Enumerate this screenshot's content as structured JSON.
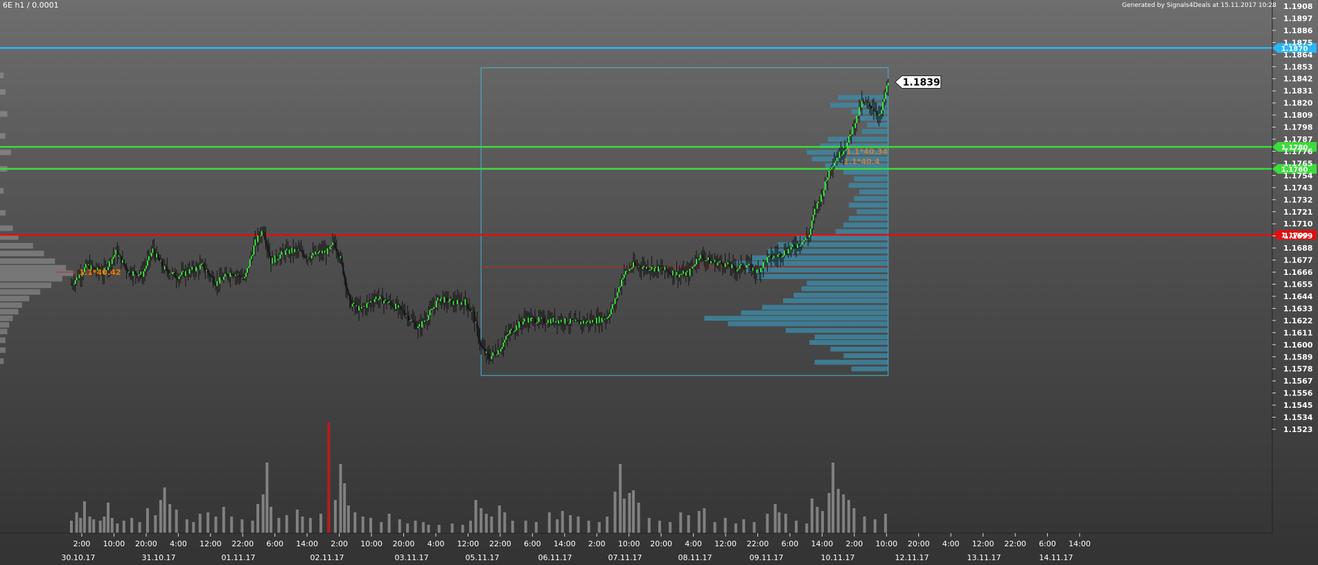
{
  "header": {
    "title": "6E h1 / 0.0001",
    "generated": "Generated by Signals4Deals at 15.11.2017 10:28"
  },
  "colors": {
    "background_top": "#6e6e6e",
    "background_bottom": "#333333",
    "bull_candle": "#39e639",
    "bear_candle": "#111111",
    "volume": "#9a9a9a",
    "volume_spike": "#b71c1c",
    "profile_fill": "#3d8aa6",
    "box_stroke": "#4ab6d4"
  },
  "chart_data": {
    "type": "candlestick",
    "title": "6E h1 / 0.0001",
    "y_ticks": [
      1.1908,
      1.1897,
      1.1886,
      1.1875,
      1.1864,
      1.1853,
      1.1842,
      1.1831,
      1.182,
      1.1809,
      1.1798,
      1.1787,
      1.1776,
      1.1765,
      1.1754,
      1.1743,
      1.1732,
      1.1721,
      1.171,
      1.1699,
      1.1688,
      1.1677,
      1.1666,
      1.1655,
      1.1644,
      1.1633,
      1.1622,
      1.1611,
      1.16,
      1.1589,
      1.1578,
      1.1567,
      1.1556,
      1.1545,
      1.1534,
      1.1523
    ],
    "time_ticks": [
      "2:00",
      "10:00",
      "20:00",
      "4:00",
      "12:00",
      "22:00",
      "6:00",
      "14:00",
      "2:00",
      "10:00",
      "20:00",
      "4:00",
      "12:00",
      "22:00",
      "6:00",
      "14:00",
      "2:00",
      "10:00",
      "20:00",
      "4:00",
      "12:00",
      "22:00",
      "6:00",
      "14:00",
      "2:00",
      "10:00",
      "20:00",
      "4:00",
      "12:00",
      "22:00",
      "6:00",
      "14:00"
    ],
    "date_ticks": [
      "30.10.17",
      "31.10.17",
      "01.11.17",
      "02.11.17",
      "03.11.17",
      "05.11.17",
      "06.11.17",
      "07.11.17",
      "08.11.17",
      "09.11.17",
      "10.11.17",
      "12.11.17",
      "13.11.17",
      "14.11.17"
    ],
    "price_path": [
      [
        0,
        1.1655
      ],
      [
        12,
        1.1672
      ],
      [
        24,
        1.1665
      ],
      [
        34,
        1.1684
      ],
      [
        44,
        1.1666
      ],
      [
        54,
        1.1664
      ],
      [
        62,
        1.1686
      ],
      [
        70,
        1.167
      ],
      [
        80,
        1.1662
      ],
      [
        90,
        1.1667
      ],
      [
        100,
        1.1672
      ],
      [
        110,
        1.1656
      ],
      [
        122,
        1.1666
      ],
      [
        132,
        1.166
      ],
      [
        140,
        1.1693
      ],
      [
        146,
        1.1705
      ],
      [
        152,
        1.1676
      ],
      [
        162,
        1.1684
      ],
      [
        172,
        1.1686
      ],
      [
        180,
        1.168
      ],
      [
        190,
        1.1684
      ],
      [
        196,
        1.1685
      ],
      [
        200,
        1.1693
      ],
      [
        205,
        1.1678
      ],
      [
        212,
        1.1638
      ],
      [
        220,
        1.1632
      ],
      [
        232,
        1.1643
      ],
      [
        244,
        1.1637
      ],
      [
        254,
        1.1629
      ],
      [
        264,
        1.1615
      ],
      [
        272,
        1.1627
      ],
      [
        280,
        1.1642
      ],
      [
        292,
        1.1638
      ],
      [
        300,
        1.1639
      ],
      [
        306,
        1.1628
      ],
      [
        312,
        1.1598
      ],
      [
        318,
        1.1588
      ],
      [
        326,
        1.1596
      ],
      [
        334,
        1.1612
      ],
      [
        346,
        1.1623
      ],
      [
        360,
        1.1622
      ],
      [
        372,
        1.1622
      ],
      [
        384,
        1.162
      ],
      [
        396,
        1.1621
      ],
      [
        408,
        1.1625
      ],
      [
        414,
        1.164
      ],
      [
        420,
        1.1663
      ],
      [
        428,
        1.1672
      ],
      [
        440,
        1.167
      ],
      [
        452,
        1.1668
      ],
      [
        462,
        1.1664
      ],
      [
        470,
        1.1665
      ],
      [
        478,
        1.1681
      ],
      [
        486,
        1.1676
      ],
      [
        496,
        1.1674
      ],
      [
        506,
        1.1669
      ],
      [
        514,
        1.1673
      ],
      [
        522,
        1.1666
      ],
      [
        530,
        1.1678
      ],
      [
        540,
        1.1682
      ],
      [
        548,
        1.1688
      ],
      [
        556,
        1.1693
      ],
      [
        562,
        1.17
      ],
      [
        566,
        1.1722
      ],
      [
        572,
        1.1738
      ],
      [
        578,
        1.1762
      ],
      [
        584,
        1.1772
      ],
      [
        590,
        1.178
      ],
      [
        596,
        1.18
      ],
      [
        602,
        1.182
      ],
      [
        610,
        1.1816
      ],
      [
        616,
        1.1808
      ],
      [
        622,
        1.1839
      ]
    ],
    "volume_profile": {
      "box": {
        "x_start": 312,
        "x_end": 622,
        "y_low": 1.1572,
        "y_high": 1.1852
      },
      "max_width_bars": 140,
      "levels": [
        [
          1.1825,
          38
        ],
        [
          1.1818,
          44
        ],
        [
          1.1812,
          28
        ],
        [
          1.1806,
          22
        ],
        [
          1.18,
          16
        ],
        [
          1.1794,
          20
        ],
        [
          1.1787,
          46
        ],
        [
          1.1781,
          52
        ],
        [
          1.1775,
          62
        ],
        [
          1.1769,
          58
        ],
        [
          1.1763,
          48
        ],
        [
          1.1757,
          34
        ],
        [
          1.1751,
          26
        ],
        [
          1.1745,
          30
        ],
        [
          1.1739,
          22
        ],
        [
          1.1733,
          26
        ],
        [
          1.1727,
          30
        ],
        [
          1.1721,
          24
        ],
        [
          1.1715,
          30
        ],
        [
          1.1709,
          34
        ],
        [
          1.1703,
          40
        ],
        [
          1.1697,
          70
        ],
        [
          1.1691,
          84
        ],
        [
          1.1685,
          92
        ],
        [
          1.1679,
          104
        ],
        [
          1.1674,
          118
        ],
        [
          1.1668,
          108
        ],
        [
          1.1662,
          100
        ],
        [
          1.1656,
          62
        ],
        [
          1.1651,
          66
        ],
        [
          1.1645,
          72
        ],
        [
          1.164,
          80
        ],
        [
          1.1634,
          96
        ],
        [
          1.1629,
          112
        ],
        [
          1.1624,
          140
        ],
        [
          1.1619,
          122
        ],
        [
          1.1613,
          78
        ],
        [
          1.1607,
          56
        ],
        [
          1.1602,
          60
        ],
        [
          1.1596,
          44
        ],
        [
          1.159,
          34
        ],
        [
          1.1584,
          56
        ],
        [
          1.1578,
          28
        ]
      ]
    },
    "left_profile": {
      "max_width_bars": 40,
      "levels": [
        [
          1.1845,
          2
        ],
        [
          1.183,
          3
        ],
        [
          1.181,
          4
        ],
        [
          1.179,
          3
        ],
        [
          1.1775,
          6
        ],
        [
          1.176,
          4
        ],
        [
          1.174,
          2
        ],
        [
          1.172,
          3
        ],
        [
          1.1706,
          7
        ],
        [
          1.1698,
          10
        ],
        [
          1.169,
          18
        ],
        [
          1.1683,
          24
        ],
        [
          1.1676,
          30
        ],
        [
          1.167,
          36
        ],
        [
          1.1665,
          40
        ],
        [
          1.166,
          34
        ],
        [
          1.1654,
          28
        ],
        [
          1.1648,
          22
        ],
        [
          1.1642,
          16
        ],
        [
          1.1636,
          12
        ],
        [
          1.163,
          10
        ],
        [
          1.1624,
          7
        ],
        [
          1.1618,
          5
        ],
        [
          1.1612,
          4
        ],
        [
          1.1604,
          3
        ],
        [
          1.1595,
          3
        ],
        [
          1.1585,
          2
        ]
      ]
    },
    "volume_bars": [
      [
        0,
        18
      ],
      [
        4,
        30
      ],
      [
        7,
        22
      ],
      [
        10,
        46
      ],
      [
        14,
        24
      ],
      [
        17,
        20
      ],
      [
        22,
        18
      ],
      [
        25,
        24
      ],
      [
        28,
        44
      ],
      [
        31,
        22
      ],
      [
        35,
        14
      ],
      [
        40,
        18
      ],
      [
        46,
        22
      ],
      [
        52,
        16
      ],
      [
        58,
        36
      ],
      [
        64,
        26
      ],
      [
        68,
        48
      ],
      [
        71,
        66
      ],
      [
        75,
        42
      ],
      [
        80,
        34
      ],
      [
        88,
        20
      ],
      [
        93,
        16
      ],
      [
        98,
        28
      ],
      [
        104,
        30
      ],
      [
        110,
        24
      ],
      [
        116,
        38
      ],
      [
        122,
        24
      ],
      [
        130,
        20
      ],
      [
        138,
        18
      ],
      [
        142,
        42
      ],
      [
        146,
        56
      ],
      [
        149,
        102
      ],
      [
        152,
        38
      ],
      [
        158,
        22
      ],
      [
        164,
        26
      ],
      [
        172,
        34
      ],
      [
        176,
        24
      ],
      [
        182,
        22
      ],
      [
        190,
        28
      ],
      [
        196,
        30
      ],
      [
        201,
        48
      ],
      [
        205,
        100
      ],
      [
        208,
        72
      ],
      [
        211,
        40
      ],
      [
        216,
        30
      ],
      [
        222,
        24
      ],
      [
        228,
        22
      ],
      [
        236,
        16
      ],
      [
        242,
        28
      ],
      [
        250,
        20
      ],
      [
        256,
        14
      ],
      [
        262,
        18
      ],
      [
        268,
        16
      ],
      [
        272,
        12
      ],
      [
        280,
        12
      ],
      [
        290,
        14
      ],
      [
        298,
        12
      ],
      [
        304,
        18
      ],
      [
        308,
        48
      ],
      [
        312,
        36
      ],
      [
        316,
        28
      ],
      [
        320,
        24
      ],
      [
        326,
        40
      ],
      [
        330,
        30
      ],
      [
        336,
        18
      ],
      [
        346,
        18
      ],
      [
        354,
        16
      ],
      [
        364,
        30
      ],
      [
        370,
        20
      ],
      [
        374,
        32
      ],
      [
        380,
        26
      ],
      [
        386,
        24
      ],
      [
        394,
        18
      ],
      [
        402,
        16
      ],
      [
        408,
        24
      ],
      [
        414,
        60
      ],
      [
        418,
        100
      ],
      [
        421,
        50
      ],
      [
        425,
        58
      ],
      [
        428,
        62
      ],
      [
        432,
        44
      ],
      [
        440,
        22
      ],
      [
        448,
        18
      ],
      [
        456,
        16
      ],
      [
        464,
        30
      ],
      [
        470,
        26
      ],
      [
        478,
        32
      ],
      [
        482,
        36
      ],
      [
        490,
        16
      ],
      [
        498,
        22
      ],
      [
        506,
        14
      ],
      [
        512,
        20
      ],
      [
        520,
        16
      ],
      [
        530,
        28
      ],
      [
        536,
        42
      ],
      [
        539,
        30
      ],
      [
        544,
        28
      ],
      [
        552,
        18
      ],
      [
        560,
        14
      ],
      [
        564,
        50
      ],
      [
        568,
        38
      ],
      [
        572,
        32
      ],
      [
        577,
        58
      ],
      [
        580,
        102
      ],
      [
        584,
        64
      ],
      [
        588,
        56
      ],
      [
        592,
        48
      ],
      [
        596,
        36
      ],
      [
        604,
        24
      ],
      [
        612,
        20
      ],
      [
        620,
        28
      ]
    ],
    "volume_spike": [
      196,
      160
    ],
    "h_lines": [
      {
        "value": 1.187,
        "label": "1.1870",
        "color": "#29b6f6"
      },
      {
        "value": 1.178,
        "label": "1.1780",
        "color": "#3cdc3c"
      },
      {
        "value": 1.176,
        "label": "1.1760",
        "color": "#3cdc3c"
      },
      {
        "value": 1.17,
        "label": "1.1700",
        "color": "#e01010"
      }
    ],
    "thin_red_lines": [
      {
        "value": 1.1666,
        "x_start": -12,
        "x_end": 30
      },
      {
        "value": 1.1671,
        "x_start": 312,
        "x_end": 622
      }
    ],
    "last_price": {
      "value": 1.1839,
      "label": "1.1839"
    },
    "poc_label": {
      "value": 1.1666,
      "x": 6,
      "label": "1.1*40.42"
    },
    "profile_labels": [
      {
        "value": 1.1776,
        "x": 590,
        "label": "1.1*40.34"
      },
      {
        "value": 1.1767,
        "x": 588,
        "label": "1.1*40.4"
      }
    ]
  }
}
